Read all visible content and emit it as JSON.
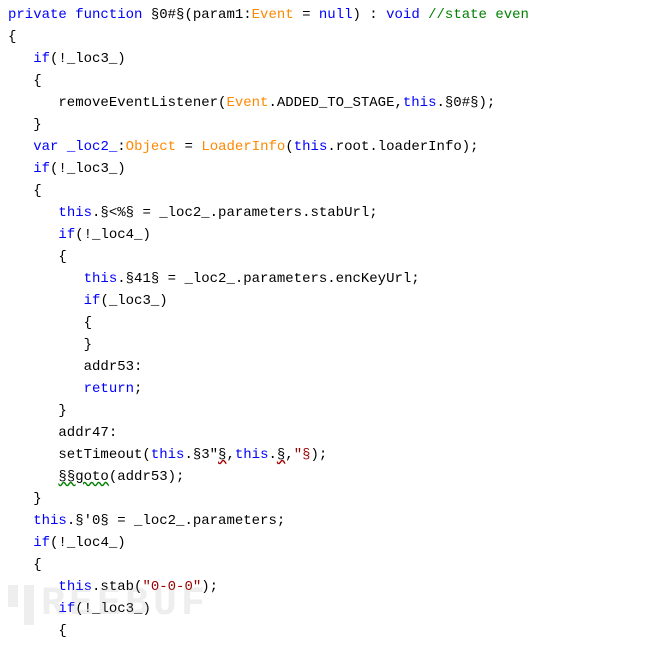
{
  "watermark": "REEBUF",
  "lines": [
    [
      {
        "cls": "kw",
        "text": "private"
      },
      {
        "text": " "
      },
      {
        "cls": "kw",
        "text": "function"
      },
      {
        "text": " §0#§(param1:"
      },
      {
        "cls": "cls",
        "text": "Event"
      },
      {
        "text": " = "
      },
      {
        "cls": "kw",
        "text": "null"
      },
      {
        "text": ") : "
      },
      {
        "cls": "typ",
        "text": "void"
      },
      {
        "text": " "
      },
      {
        "cls": "cmt",
        "text": "//state even"
      }
    ],
    [
      {
        "text": "{"
      }
    ],
    [
      {
        "text": "   "
      },
      {
        "cls": "kw",
        "text": "if"
      },
      {
        "text": "(!_loc3_)"
      }
    ],
    [
      {
        "text": "   {"
      }
    ],
    [
      {
        "text": "      removeEventListener("
      },
      {
        "cls": "cls",
        "text": "Event"
      },
      {
        "text": ".ADDED_TO_STAGE,"
      },
      {
        "cls": "kw",
        "text": "this"
      },
      {
        "text": ".§0#§);"
      }
    ],
    [
      {
        "text": "   }"
      }
    ],
    [
      {
        "text": "   "
      },
      {
        "cls": "kw",
        "text": "var"
      },
      {
        "text": " "
      },
      {
        "cls": "var",
        "text": "_loc2_"
      },
      {
        "text": ":"
      },
      {
        "cls": "cls",
        "text": "Object"
      },
      {
        "text": " = "
      },
      {
        "cls": "cls",
        "text": "LoaderInfo"
      },
      {
        "text": "("
      },
      {
        "cls": "kw",
        "text": "this"
      },
      {
        "text": ".root.loaderInfo);"
      }
    ],
    [
      {
        "text": "   "
      },
      {
        "cls": "kw",
        "text": "if"
      },
      {
        "text": "(!_loc3_)"
      }
    ],
    [
      {
        "text": "   {"
      }
    ],
    [
      {
        "text": "      "
      },
      {
        "cls": "kw",
        "text": "this"
      },
      {
        "text": ".§<%§ = _loc2_.parameters.stabUrl;"
      }
    ],
    [
      {
        "text": "      "
      },
      {
        "cls": "kw",
        "text": "if"
      },
      {
        "text": "(!_loc4_)"
      }
    ],
    [
      {
        "text": "      {"
      }
    ],
    [
      {
        "text": "         "
      },
      {
        "cls": "kw",
        "text": "this"
      },
      {
        "text": ".§41§ = _loc2_.parameters.encKeyUrl;"
      }
    ],
    [
      {
        "text": "         "
      },
      {
        "cls": "kw",
        "text": "if"
      },
      {
        "text": "(_loc3_)"
      }
    ],
    [
      {
        "text": "         {"
      }
    ],
    [
      {
        "text": "         }"
      }
    ],
    [
      {
        "text": "         addr53:"
      }
    ],
    [
      {
        "text": "         "
      },
      {
        "cls": "kw",
        "text": "return"
      },
      {
        "text": ";"
      }
    ],
    [
      {
        "text": "      }"
      }
    ],
    [
      {
        "text": "      addr47:"
      }
    ],
    [
      {
        "text": "      setTimeout("
      },
      {
        "cls": "kw",
        "text": "this"
      },
      {
        "text": ".§3\""
      },
      {
        "cls": "err",
        "text": "§"
      },
      {
        "text": ","
      },
      {
        "cls": "kw",
        "text": "this"
      },
      {
        "text": "."
      },
      {
        "cls": "err",
        "text": "§"
      },
      {
        "text": ","
      },
      {
        "cls": "str",
        "text": "\"§"
      },
      {
        "text": ");"
      }
    ],
    [
      {
        "text": "      "
      },
      {
        "cls": "errg",
        "text": "§§goto"
      },
      {
        "text": "(addr53);"
      }
    ],
    [
      {
        "text": "   }"
      }
    ],
    [
      {
        "text": "   "
      },
      {
        "cls": "kw",
        "text": "this"
      },
      {
        "text": ".§'0§ = _loc2_.parameters;"
      }
    ],
    [
      {
        "text": "   "
      },
      {
        "cls": "kw",
        "text": "if"
      },
      {
        "text": "(!_loc4_)"
      }
    ],
    [
      {
        "text": "   {"
      }
    ],
    [
      {
        "text": "      "
      },
      {
        "cls": "kw",
        "text": "this"
      },
      {
        "text": ".stab("
      },
      {
        "cls": "str",
        "text": "\"0-0-0\""
      },
      {
        "text": ");"
      }
    ],
    [
      {
        "text": "      "
      },
      {
        "cls": "kw",
        "text": "if"
      },
      {
        "text": "(!_loc3_)"
      }
    ],
    [
      {
        "text": "      {"
      }
    ]
  ]
}
